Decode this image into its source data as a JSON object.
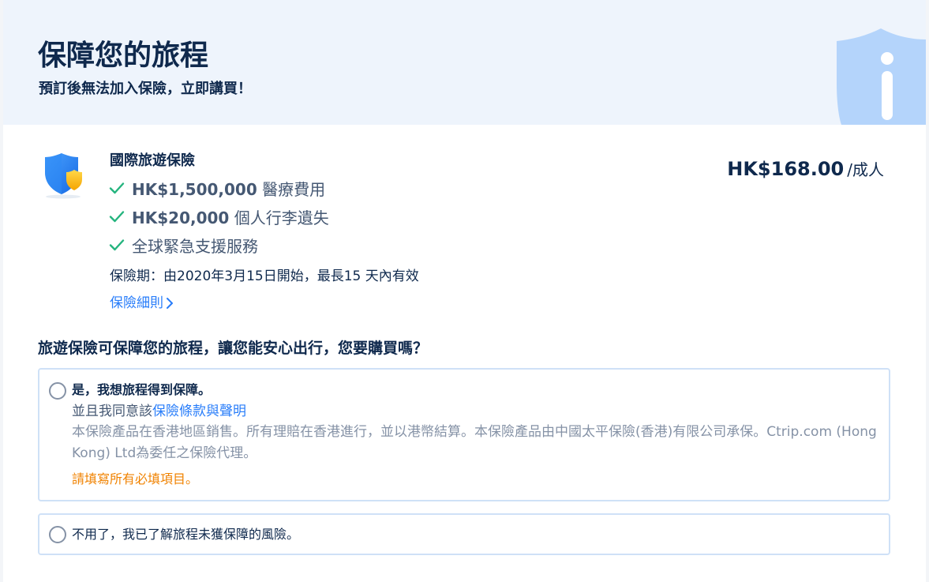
{
  "header": {
    "title": "保障您的旅程",
    "subtitle": "預訂後無法加入保險，立即講買！",
    "icon": "shield-info-icon"
  },
  "product": {
    "icon": "insurance-shield-icon",
    "name": "國際旅遊保險",
    "benefits": [
      {
        "amount": "HK$1,500,000",
        "text": " 醫療費用"
      },
      {
        "amount": "HK$20,000",
        "text": " 個人行李遺失"
      },
      {
        "amount": "",
        "text": "全球緊急支援服務"
      }
    ],
    "period": "保險期：由2020年3月15日開始，最長15 天內有效",
    "details_link": "保險細則",
    "price": "HK$168.00",
    "price_unit": "/成人"
  },
  "question": "旅遊保險可保障您的旅程，讓您能安心出行，您要購買嗎？",
  "options": {
    "yes": {
      "label": "是，我想旅程得到保障。",
      "agree_prefix": "並且我同意該",
      "agree_link": "保險條款與聲明",
      "disclaimer": "本保險產品在香港地區銷售。所有理賠在香港進行，並以港幣結算。本保險產品由中國太平保險(香港)有限公司承保。Ctrip.com (Hong Kong) Ltd為委任之保險代理。",
      "error": "請填寫所有必填項目。",
      "selected": false
    },
    "no": {
      "label": "不用了，我已了解旅程未獲保障的風險。",
      "selected": false
    }
  },
  "colors": {
    "title": "#0f294d",
    "link": "#287dfa",
    "check": "#24b47e",
    "error": "#f08200",
    "border": "#cfe1f7",
    "hero_bg": "#eef4fc"
  }
}
